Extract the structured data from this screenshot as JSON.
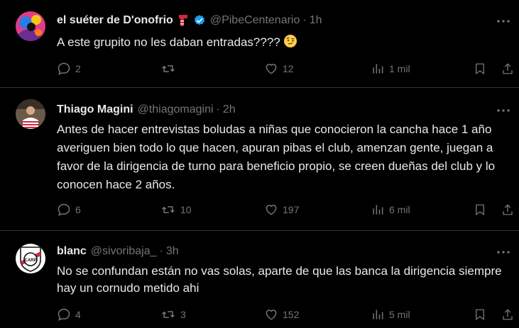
{
  "tweets": [
    {
      "name": "el suéter de D'onofrio",
      "name_emoji": "scarf-emoji",
      "verified": true,
      "handle": "@PibeCentenario",
      "time": "1h",
      "text": "A este grupito no les daban entradas???? ",
      "text_emoji": "raised-eyebrow-emoji",
      "replies": "2",
      "retweets": "",
      "likes": "12",
      "views": "1 mil"
    },
    {
      "name": "Thiago Magini",
      "handle": "@thiagomagini",
      "time": "2h",
      "text": "Antes de hacer entrevistas boludas a niñas que conocieron la cancha hace 1 año averiguen bien todo lo que hacen, apuran pibas el club, amenzan gente, juegan a favor de la dirigencia de turno para beneficio propio,  se creen dueñas del club y lo conocen hace 2 años.",
      "replies": "6",
      "retweets": "10",
      "likes": "197",
      "views": "6 mil"
    },
    {
      "name": "blanc",
      "handle": "@sivoribaja_",
      "time": "3h",
      "avatar_text": "CARP",
      "text": "No se confundan están no vas solas, aparte de que las banca la dirigencia siempre hay un cornudo metido ahi",
      "replies": "4",
      "retweets": "3",
      "likes": "152",
      "views": "5 mil"
    }
  ],
  "colors": {
    "background": "#000000",
    "text": "#e7e9ea",
    "muted": "#71767b",
    "border": "#2f3336",
    "verified": "#1d9bf0"
  }
}
